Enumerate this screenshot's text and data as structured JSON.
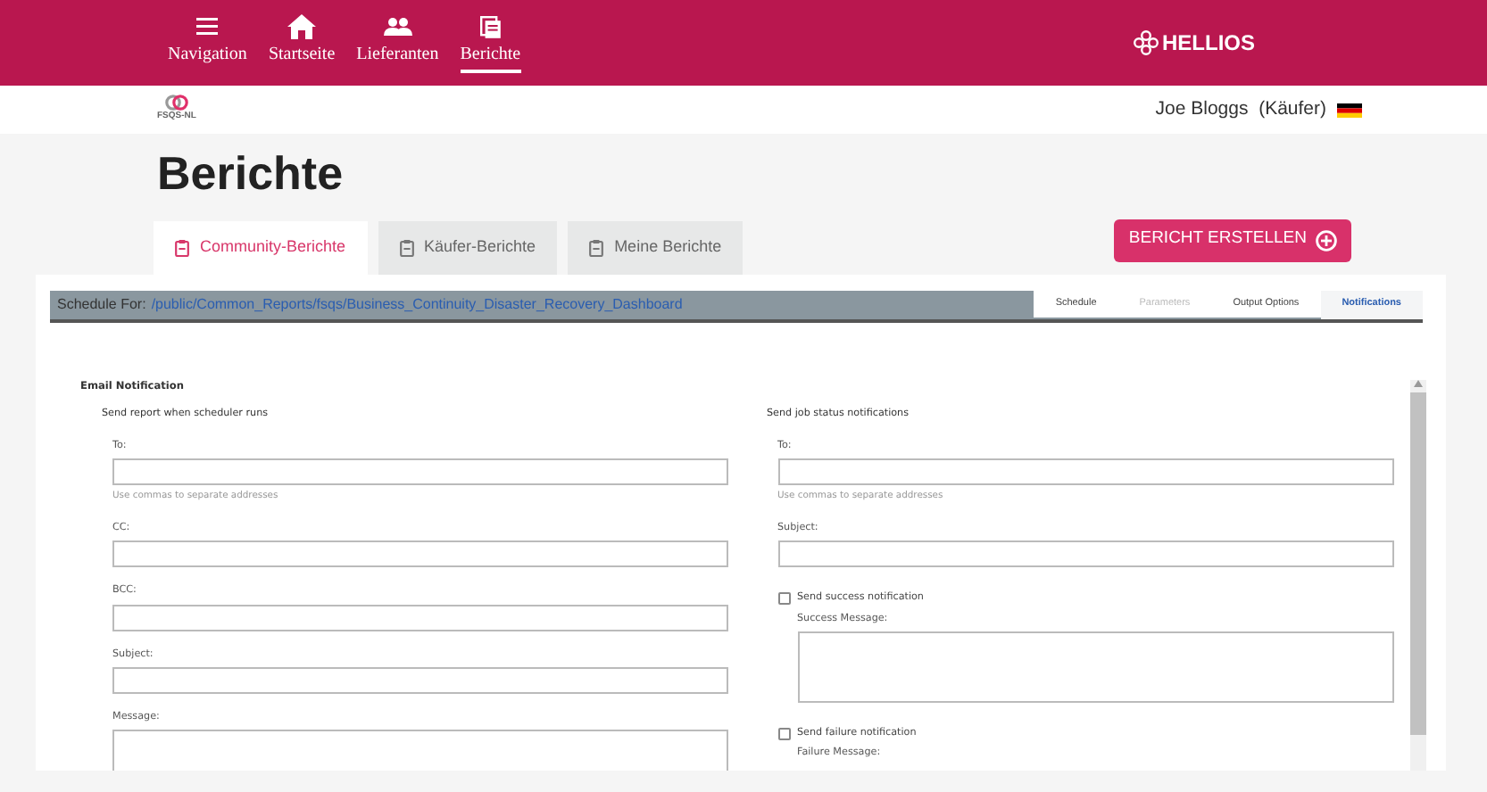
{
  "navbar": {
    "items": [
      {
        "label": "Navigation",
        "selected": false
      },
      {
        "label": "Startseite",
        "selected": false
      },
      {
        "label": "Lieferanten",
        "selected": false
      },
      {
        "label": "Berichte",
        "selected": true
      }
    ],
    "brand": "HELLIOS"
  },
  "header": {
    "org_logo": "FSQS-NL",
    "user": "Joe Bloggs  (Käufer)"
  },
  "page_title": "Berichte",
  "report_tabs": [
    {
      "label": "Community-Berichte",
      "selected": true
    },
    {
      "label": "Käufer-Berichte",
      "selected": false
    },
    {
      "label": "Meine Berichte",
      "selected": false
    }
  ],
  "create_button": "BERICHT ERSTELLEN",
  "schedule": {
    "label": "Schedule For:",
    "path": "/public/Common_Reports/fsqs/Business_Continuity_Disaster_Recovery_Dashboard",
    "tabs": [
      {
        "label": "Schedule",
        "selected": false,
        "disabled": false
      },
      {
        "label": "Parameters",
        "selected": false,
        "disabled": true
      },
      {
        "label": "Output Options",
        "selected": false,
        "disabled": false
      },
      {
        "label": "Notifications",
        "selected": true,
        "disabled": false
      }
    ]
  },
  "email_notification": {
    "title": "Email Notification",
    "columns": [
      {
        "title": "Send report when scheduler runs",
        "fields": [
          {
            "kind": "input",
            "label": "To:",
            "hint": "Use commas to separate addresses"
          },
          {
            "kind": "input",
            "label": "CC:"
          },
          {
            "kind": "input",
            "label": "BCC:"
          },
          {
            "kind": "input",
            "label": "Subject:"
          },
          {
            "kind": "textarea",
            "label": "Message:"
          }
        ]
      },
      {
        "title": "Send job status notifications",
        "fields": [
          {
            "kind": "input",
            "label": "To:",
            "hint": "Use commas to separate addresses"
          },
          {
            "kind": "input",
            "label": "Subject:"
          },
          {
            "kind": "checkbox",
            "label": "Send success notification",
            "checked": false
          },
          {
            "kind": "textarea",
            "label": "Success Message:",
            "indented": true
          },
          {
            "kind": "checkbox",
            "label": "Send failure notification",
            "checked": false
          },
          {
            "kind": "label",
            "label": "Failure Message:",
            "indented": true
          }
        ]
      }
    ]
  }
}
